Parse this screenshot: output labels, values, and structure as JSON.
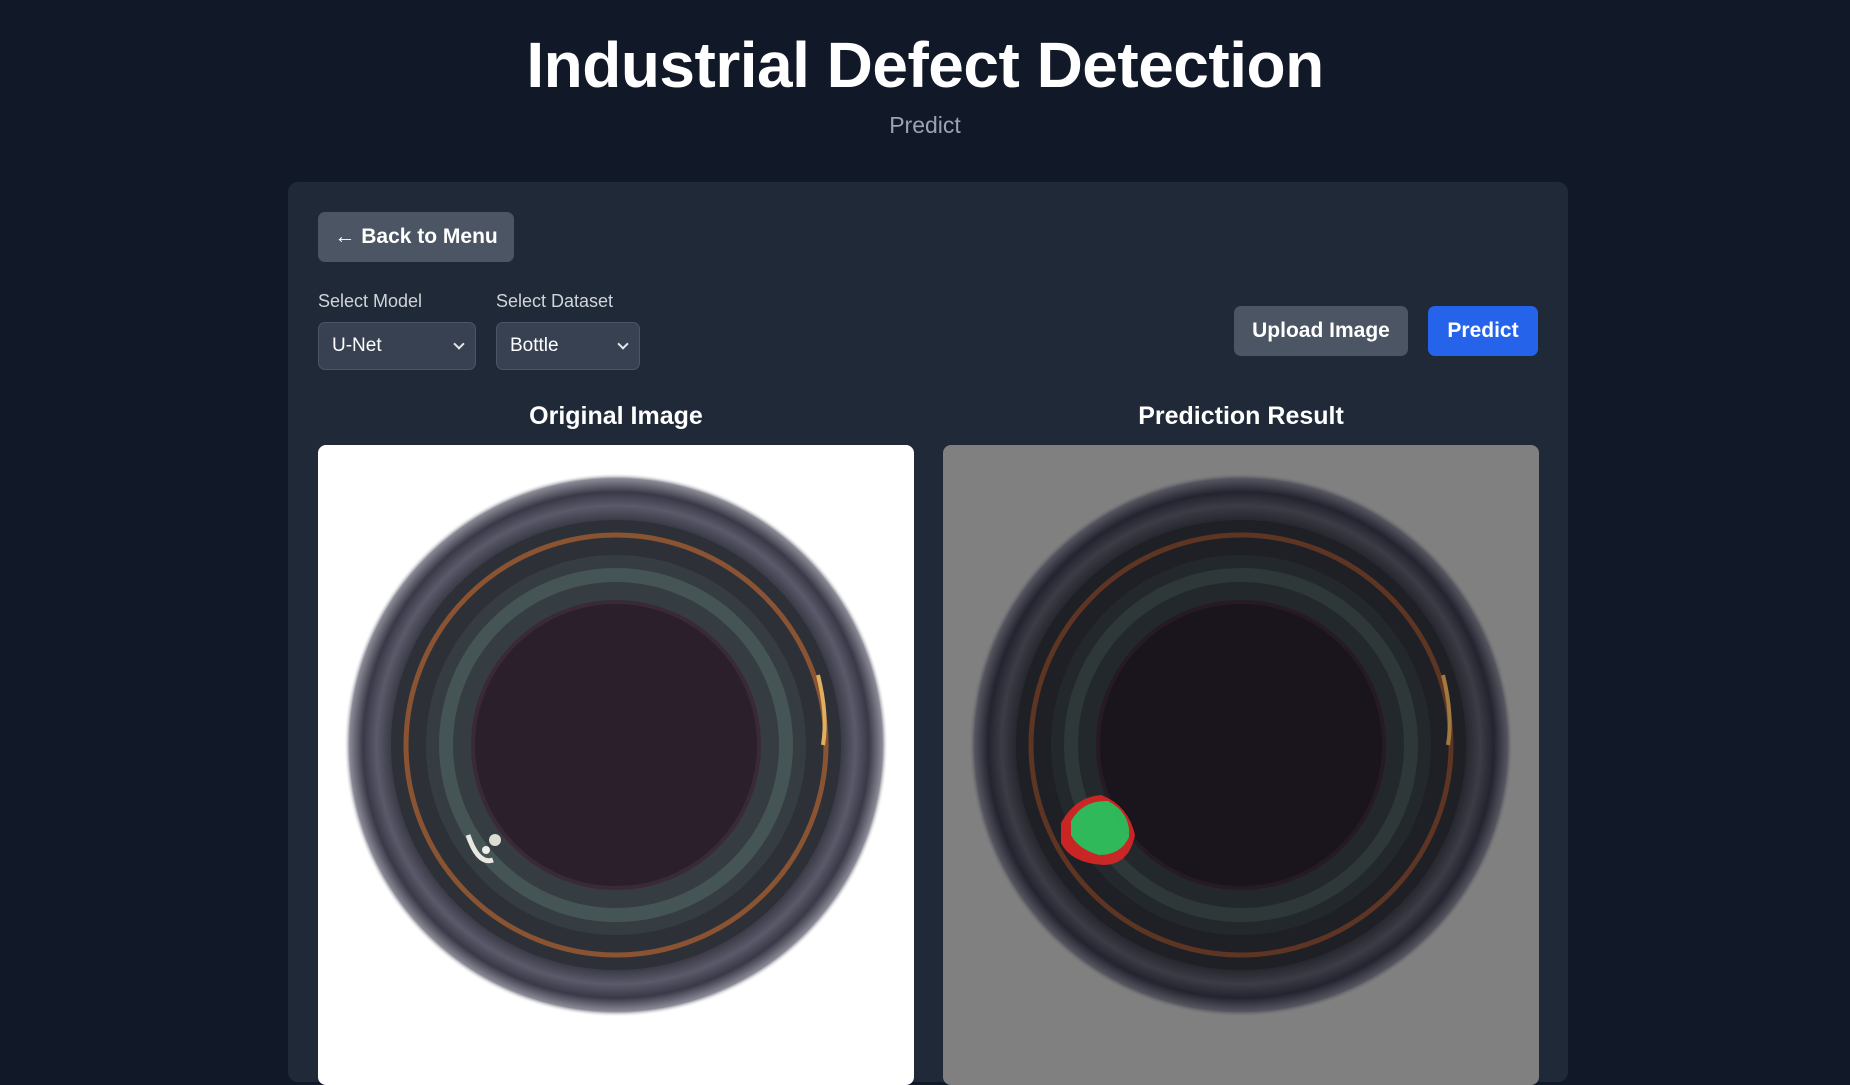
{
  "header": {
    "title": "Industrial Defect Detection",
    "subtitle": "Predict"
  },
  "controls": {
    "back_label": "Back to Menu",
    "back_icon": "arrow-left-icon",
    "model_label": "Select Model",
    "model_value": "U-Net",
    "dataset_label": "Select Dataset",
    "dataset_value": "Bottle",
    "upload_label": "Upload Image",
    "predict_label": "Predict"
  },
  "results": {
    "original_title": "Original Image",
    "prediction_title": "Prediction Result"
  },
  "colors": {
    "background": "#111827",
    "panel": "#1f2937",
    "primary_button": "#2563eb",
    "secondary_button": "#4b5563",
    "prediction_mask": "#22c55e",
    "ground_truth_mask": "#dc2626"
  }
}
